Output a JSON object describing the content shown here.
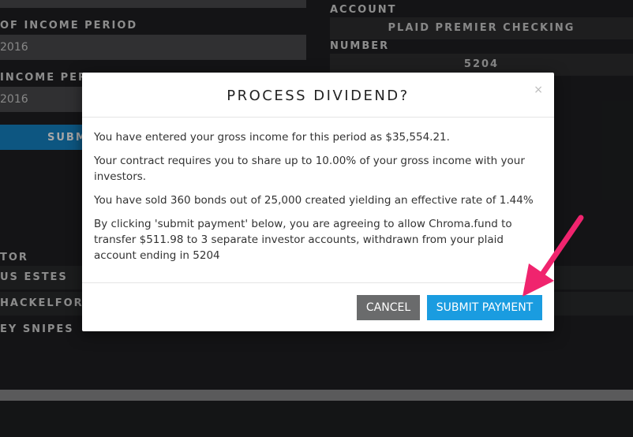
{
  "background": {
    "left": {
      "income_period_label": "OF INCOME PERIOD",
      "income_period_value": "2016",
      "income_period2_label": "INCOME PER",
      "income_period2_value": "2016",
      "submit_label": "SUBMI",
      "investor_label": "TOR",
      "investors": [
        "US ESTES",
        "HACKELFORD",
        "EY SNIPES"
      ]
    },
    "right": {
      "account_label": "ACCOUNT",
      "account_value": "PLAID PREMIER CHECKING",
      "number_label": "NUMBER",
      "number_value": "5204"
    }
  },
  "modal": {
    "title": "PROCESS DIVIDEND?",
    "close_symbol": "×",
    "paragraphs": [
      "You have entered your gross income for this period as $35,554.21.",
      "Your contract requires you to share up to 10.00% of your gross income with your investors.",
      "You have sold 360 bonds out of 25,000 created yielding an effective rate of 1.44%",
      "By clicking 'submit payment' below, you are agreeing to allow Chroma.fund to transfer $511.98 to 3 separate investor accounts, withdrawn from your plaid account ending in 5204"
    ],
    "cancel_label": "CANCEL",
    "submit_label": "SUBMIT PAYMENT"
  },
  "colors": {
    "accent": "#1a9ce0",
    "arrow": "#f0246e"
  }
}
